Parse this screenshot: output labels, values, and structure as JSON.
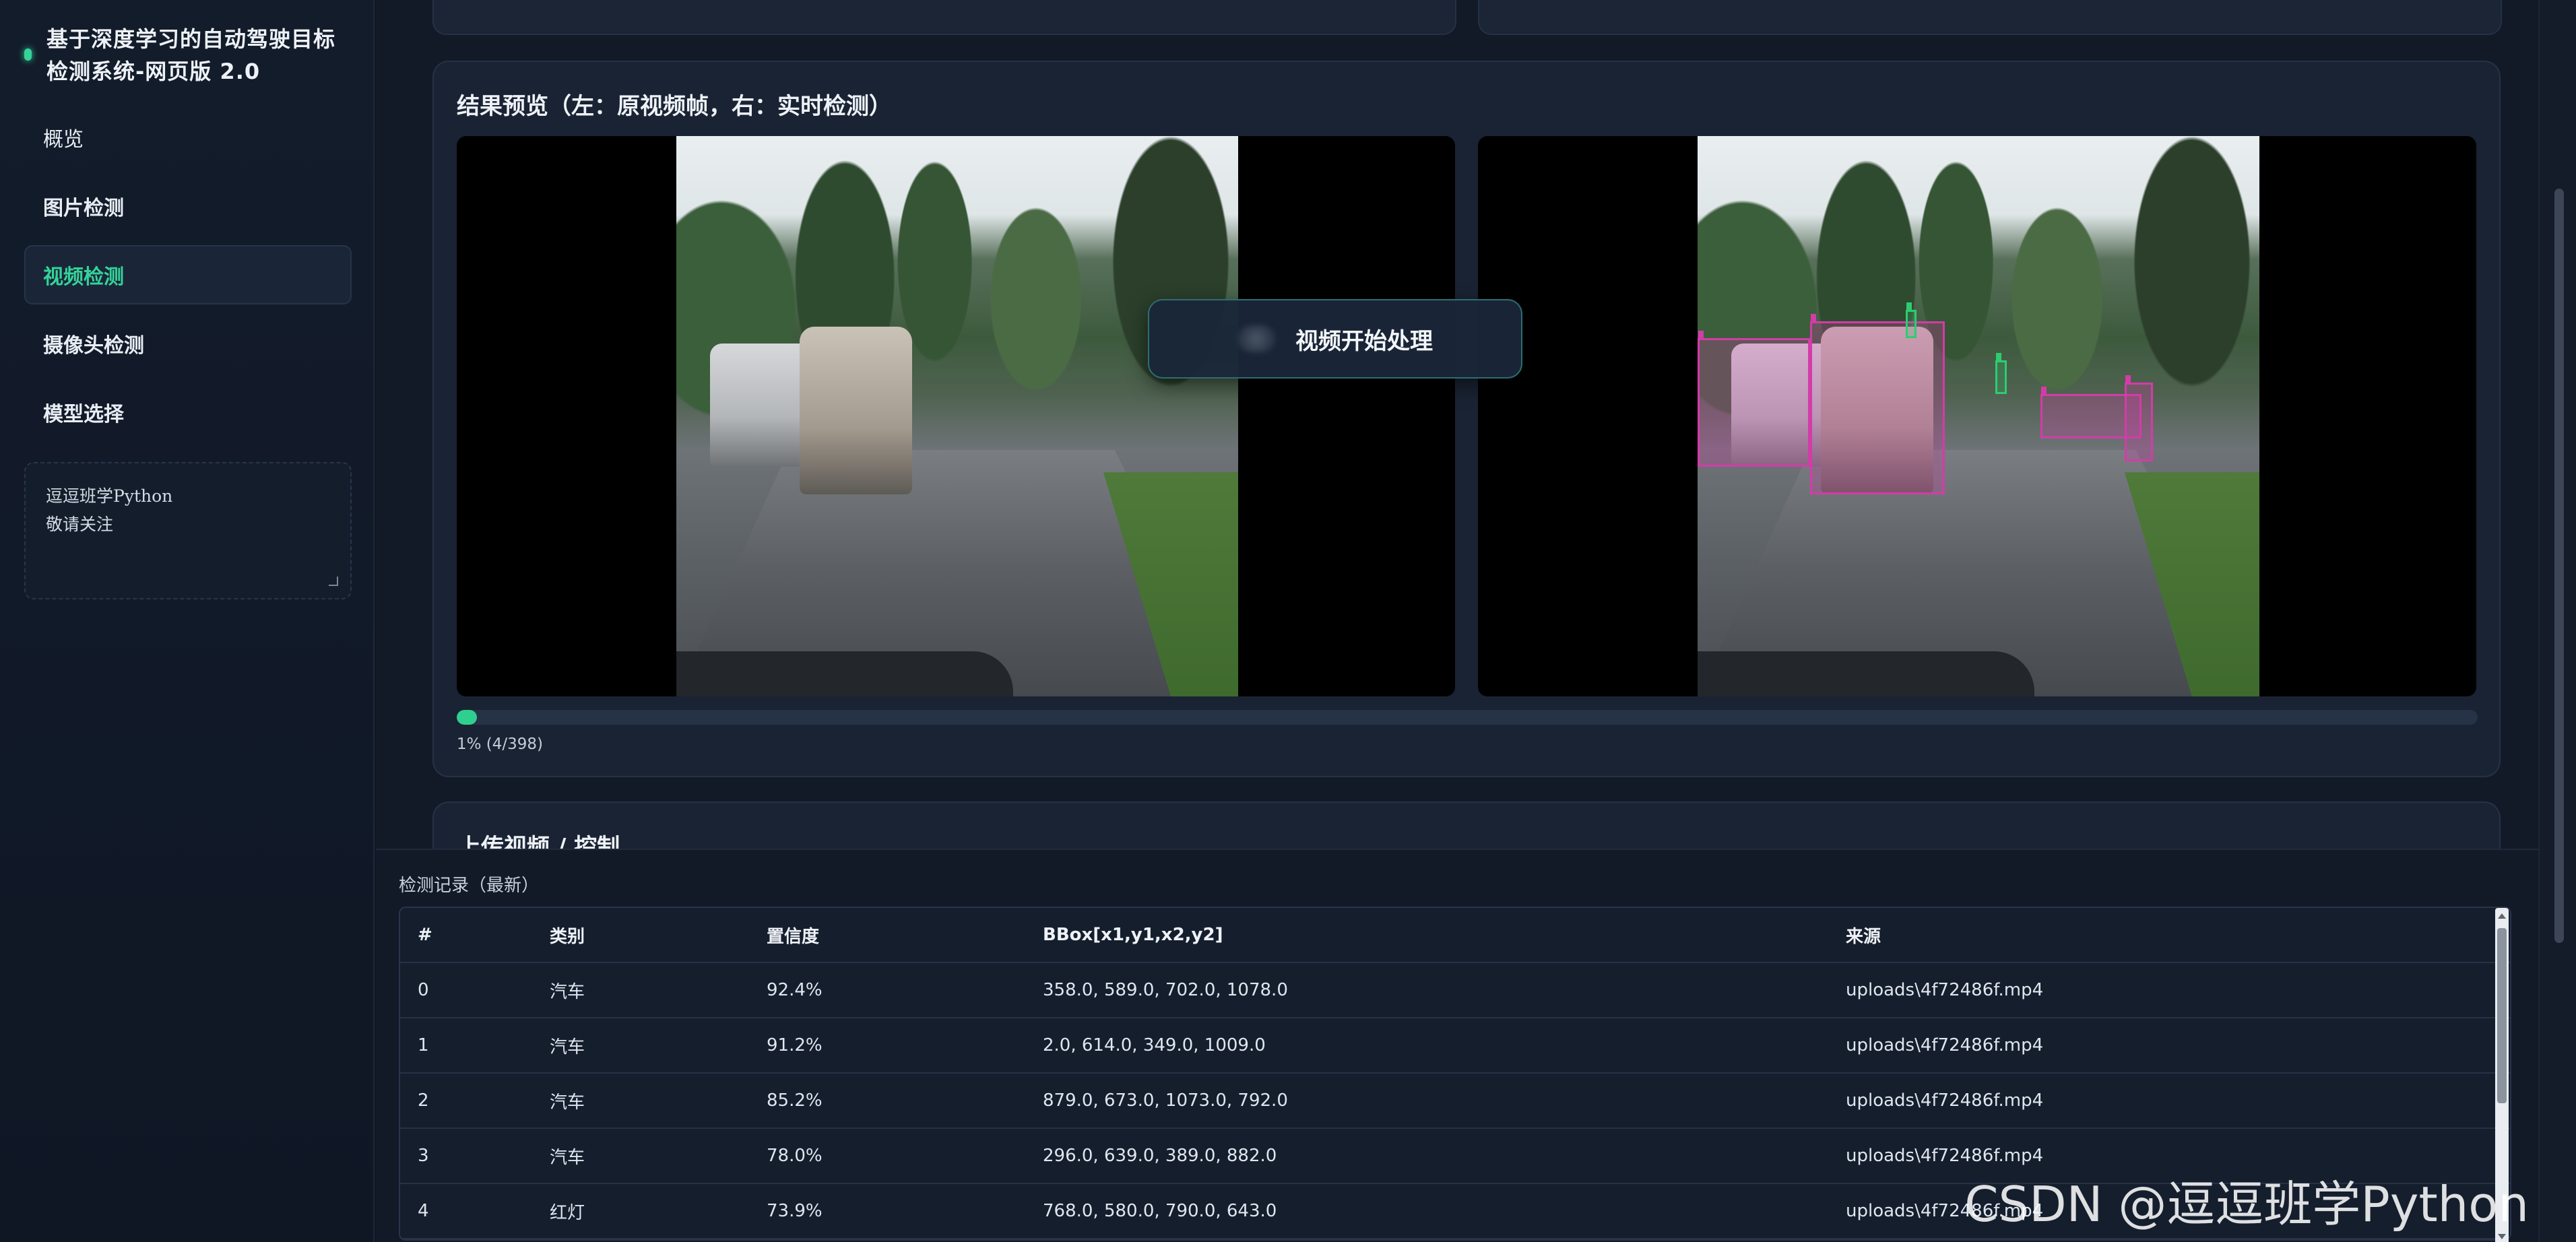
{
  "app": {
    "title": "基于深度学习的自动驾驶目标检测系统-网页版 2.0"
  },
  "sidebar": {
    "items": [
      {
        "label": "概览"
      },
      {
        "label": "图片检测"
      },
      {
        "label": "视频检测"
      },
      {
        "label": "摄像头检测"
      },
      {
        "label": "模型选择"
      }
    ],
    "active_index": 2,
    "note": {
      "line1": "逗逗班学Python",
      "line2": "敬请关注"
    }
  },
  "preview": {
    "title": "结果预览（左：原视频帧，右：实时检测）",
    "toast": "视频开始处理",
    "progress_percent": 1,
    "progress_label": "1% (4/398)"
  },
  "upload": {
    "title": "上传视频 / 控制"
  },
  "log": {
    "title": "检测记录（最新）",
    "columns": [
      "#",
      "类别",
      "置信度",
      "BBox[x1,y1,x2,y2]",
      "来源"
    ],
    "rows": [
      [
        "0",
        "汽车",
        "92.4%",
        "358.0, 589.0, 702.0, 1078.0",
        "uploads\\4f72486f.mp4"
      ],
      [
        "1",
        "汽车",
        "91.2%",
        "2.0, 614.0, 349.0, 1009.0",
        "uploads\\4f72486f.mp4"
      ],
      [
        "2",
        "汽车",
        "85.2%",
        "879.0, 673.0, 1073.0, 792.0",
        "uploads\\4f72486f.mp4"
      ],
      [
        "3",
        "汽车",
        "78.0%",
        "296.0, 639.0, 389.0, 882.0",
        "uploads\\4f72486f.mp4"
      ],
      [
        "4",
        "红灯",
        "73.9%",
        "768.0, 580.0, 790.0, 643.0",
        "uploads\\4f72486f.mp4"
      ]
    ]
  },
  "watermark": "CSDN @逗逗班学Python",
  "colors": {
    "accent": "#34d399",
    "bbox_car": "#d33ca8",
    "bbox_light": "#2ecc71",
    "background": "#121a27"
  }
}
